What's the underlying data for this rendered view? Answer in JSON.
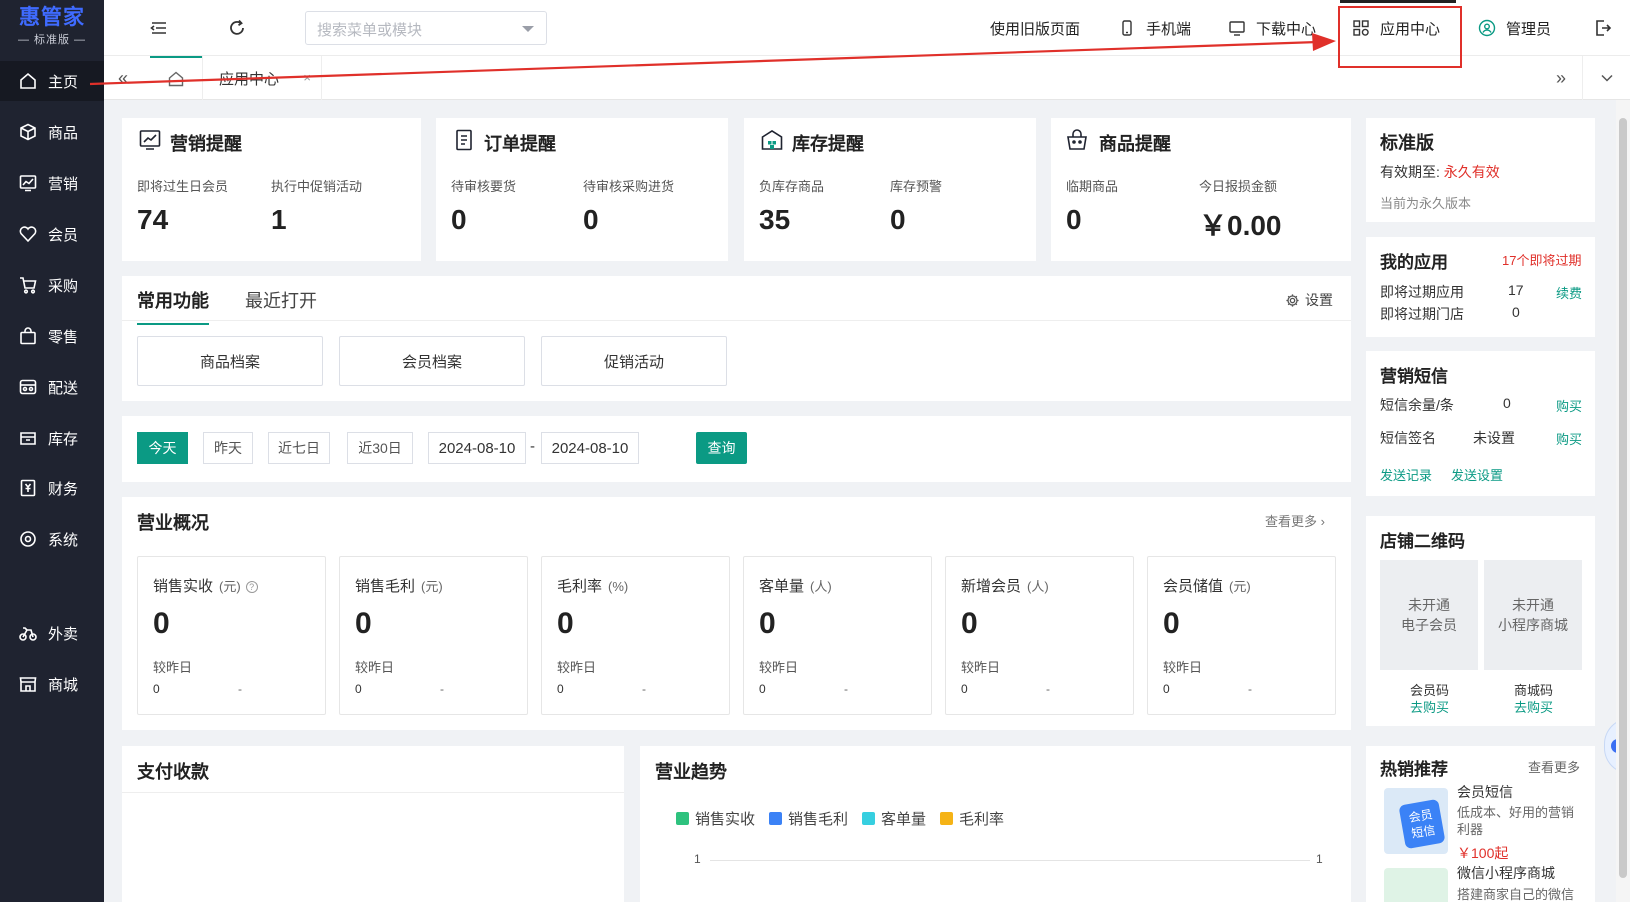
{
  "sidebar": {
    "logo_main": "惠管家",
    "logo_sub": "— 标准版 —",
    "items": [
      {
        "label": "主页",
        "icon": "home-icon"
      },
      {
        "label": "商品",
        "icon": "box-icon"
      },
      {
        "label": "营销",
        "icon": "chart-icon"
      },
      {
        "label": "会员",
        "icon": "heart-icon"
      },
      {
        "label": "采购",
        "icon": "cart-icon"
      },
      {
        "label": "零售",
        "icon": "bag-icon"
      },
      {
        "label": "配送",
        "icon": "truck-icon"
      },
      {
        "label": "库存",
        "icon": "inbox-icon"
      },
      {
        "label": "财务",
        "icon": "yen-icon"
      },
      {
        "label": "系统",
        "icon": "settings-icon"
      },
      {
        "label": "外卖",
        "icon": "bike-icon"
      },
      {
        "label": "商城",
        "icon": "store-icon"
      }
    ]
  },
  "topbar": {
    "search_placeholder": "搜索菜单或模块",
    "old_page": "使用旧版页面",
    "mobile": "手机端",
    "download": "下载中心",
    "app_center": "应用中心",
    "user": "管理员"
  },
  "tabs": {
    "app_tab": "应用中心",
    "close": "×"
  },
  "reminders": {
    "marketing": {
      "title": "营销提醒",
      "l1": "即将过生日会员",
      "v1": "74",
      "l2": "执行中促销活动",
      "v2": "1"
    },
    "order": {
      "title": "订单提醒",
      "l1": "待审核要货",
      "v1": "0",
      "l2": "待审核采购进货",
      "v2": "0"
    },
    "stock": {
      "title": "库存提醒",
      "l1": "负库存商品",
      "v1": "35",
      "l2": "库存预警",
      "v2": "0"
    },
    "goods": {
      "title": "商品提醒",
      "l1": "临期商品",
      "v1": "0",
      "l2": "今日报损金额",
      "v2": "￥0.00"
    }
  },
  "functions": {
    "tab_common": "常用功能",
    "tab_recent": "最近打开",
    "settings": "设置",
    "buttons": [
      "商品档案",
      "会员档案",
      "促销活动"
    ]
  },
  "filter": {
    "today": "今天",
    "yesterday": "昨天",
    "week": "近七日",
    "month": "近30日",
    "start_date": "2024-08-10",
    "end_date": "2024-08-10",
    "sep": "-",
    "query": "查询"
  },
  "overview": {
    "title": "营业概况",
    "more": "查看更多",
    "compare_label": "较昨日",
    "items": [
      {
        "title": "销售实收",
        "unit": "(元)",
        "value": "0",
        "prev": "0",
        "delta": "-"
      },
      {
        "title": "销售毛利",
        "unit": "(元)",
        "value": "0",
        "prev": "0",
        "delta": "-"
      },
      {
        "title": "毛利率",
        "unit": "(%)",
        "value": "0",
        "prev": "0",
        "delta": "-"
      },
      {
        "title": "客单量",
        "unit": "(人)",
        "value": "0",
        "prev": "0",
        "delta": "-"
      },
      {
        "title": "新增会员",
        "unit": "(人)",
        "value": "0",
        "prev": "0",
        "delta": "-"
      },
      {
        "title": "会员储值",
        "unit": "(元)",
        "value": "0",
        "prev": "0",
        "delta": "-"
      }
    ]
  },
  "payment": {
    "title": "支付收款"
  },
  "trend": {
    "title": "营业趋势",
    "legend": [
      {
        "name": "销售实收",
        "color": "#2ec27e"
      },
      {
        "name": "销售毛利",
        "color": "#3b82f6"
      },
      {
        "name": "客单量",
        "color": "#36cfe0"
      },
      {
        "name": "毛利率",
        "color": "#f5b316"
      }
    ],
    "y_left": "1",
    "y_right": "1"
  },
  "edition": {
    "title": "标准版",
    "valid_label": "有效期至:",
    "valid_value": "永久有效",
    "note": "当前为永久版本"
  },
  "my_apps": {
    "title": "我的应用",
    "alert": "17个即将过期",
    "r1_label": "即将过期应用",
    "r1_value": "17",
    "r1_action": "续费",
    "r2_label": "即将过期门店",
    "r2_value": "0"
  },
  "sms": {
    "title": "营销短信",
    "r1_label": "短信余量/条",
    "r1_value": "0",
    "r1_action": "购买",
    "r2_label": "短信签名",
    "r2_value": "未设置",
    "r2_action": "购买",
    "link1": "发送记录",
    "link2": "发送设置"
  },
  "qrcode": {
    "title": "店铺二维码",
    "c1_line1": "未开通",
    "c1_line2": "电子会员",
    "c1_name": "会员码",
    "c1_action": "去购买",
    "c2_line1": "未开通",
    "c2_line2": "小程序商城",
    "c2_name": "商城码",
    "c2_action": "去购买"
  },
  "hot": {
    "title": "热销推荐",
    "more": "查看更多",
    "p1_name": "会员短信",
    "p1_desc": "低成本、好用的营销利器",
    "p1_price": "￥100起",
    "p1_thumb_a": "会员",
    "p1_thumb_b": "短信",
    "p2_name": "微信小程序商城",
    "p2_desc": "搭建商家自己的微信"
  },
  "colors": {
    "accent": "#0b9a84",
    "sidebar_bg": "#1f2330",
    "alert": "#e0302a",
    "logo": "#3f6bff"
  }
}
